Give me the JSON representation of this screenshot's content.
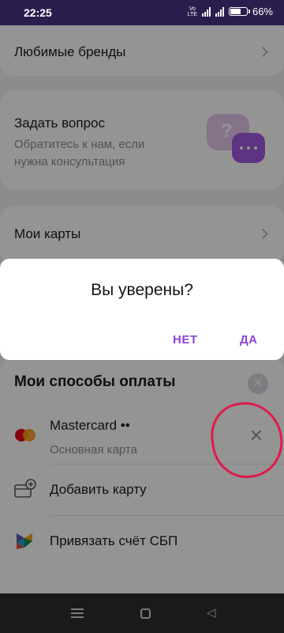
{
  "status_bar": {
    "time": "22:25",
    "network_label": "Vo LTE",
    "battery_percent": "66%",
    "battery_level": 0.66
  },
  "menu": {
    "favorite_brands": "Любимые бренды",
    "ask_question": {
      "title": "Задать вопрос",
      "subtitle_line1": "Обратитесь к нам, если",
      "subtitle_line2": "нужна консультация"
    },
    "my_cards": "Мои карты"
  },
  "payment_sheet": {
    "title": "Мои способы оплаты",
    "close_icon": "close-icon",
    "card": {
      "brand": "Mastercard",
      "mask": "••",
      "subtitle": "Основная карта"
    },
    "add_card": "Добавить карту",
    "link_sbp": "Привязать счёт СБП"
  },
  "dialog": {
    "title": "Вы уверены?",
    "no": "НЕТ",
    "yes": "ДА"
  },
  "colors": {
    "accent": "#8a44d6",
    "annotation": "#e11a4c",
    "status_bar": "#2b1d4e"
  }
}
